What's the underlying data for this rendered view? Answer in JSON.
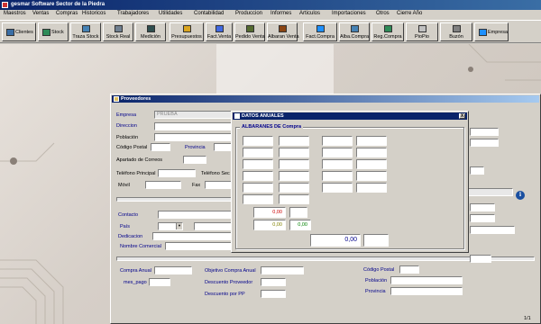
{
  "app": {
    "title": "gesmar Software Sector de la Piedra"
  },
  "menu": [
    "Maestros",
    "Ventas",
    "Compras",
    "Historicos",
    "Trabajadores",
    "Utilidades",
    "Contabilidad",
    "Produccion",
    "Informes",
    "Articulos",
    "Importaciones",
    "Otros",
    "Cierre Año"
  ],
  "toolbar": [
    {
      "label": "Clientes",
      "icon": "clients-icon",
      "color": "#3a6ea5"
    },
    {
      "label": "Stock",
      "icon": "stock-icon",
      "color": "#2e8b57"
    },
    {
      "label": "Traza Stock",
      "icon": "trace-stock-icon",
      "color": "#4682b4"
    },
    {
      "label": "Stock Real",
      "icon": "stock-real-icon",
      "color": "#708090"
    },
    {
      "label": "Medición",
      "icon": "measure-icon",
      "color": "#2f4f4f"
    },
    {
      "label": "Presupuestos",
      "icon": "budget-icon",
      "color": "#daa520"
    },
    {
      "label": "Fact.Venta",
      "icon": "sales-invoice-icon",
      "color": "#4169e1"
    },
    {
      "label": "Pedido Venta",
      "icon": "sales-order-icon",
      "color": "#556b2f"
    },
    {
      "label": "Albaran Venta",
      "icon": "delivery-note-icon",
      "color": "#8b4513"
    },
    {
      "label": "Fact.Compra",
      "icon": "purchase-invoice-icon",
      "color": "#1e90ff"
    },
    {
      "label": "Alba.Compra",
      "icon": "purchase-note-icon",
      "color": "#4682b4"
    },
    {
      "label": "Reg.Compra",
      "icon": "purchase-register-icon",
      "color": "#2e8b57"
    },
    {
      "label": "PioPio",
      "icon": "piopio-icon",
      "color": "#c0c0c0"
    },
    {
      "label": "Buzón",
      "icon": "mailbox-icon",
      "color": "#808080"
    },
    {
      "label": "Empresa",
      "icon": "company-icon",
      "color": "#1e90ff"
    }
  ],
  "proveedores": {
    "title": "Proveedores",
    "empresa_label": "Empresa",
    "empresa_value": "PRUEBA",
    "direccion_label": "Direccion",
    "poblacion_label": "Población",
    "cp_label": "Código Postal",
    "provincia_label": "Provincia",
    "apartado_label": "Apartado de Correos",
    "telefono_label": "Teléfono Principal",
    "telefono_sec_label": "Teléfono Sec",
    "movil_label": "Móvil",
    "fax_label": "Fax",
    "contacto_label": "Contacto",
    "pais_label": "País",
    "dedicacion_label": "Dedicacion",
    "nombre_comercial_label": "Nombre Comercial",
    "compra_anual_label": "Compra Anual",
    "mes_pago_label": "mes_pago",
    "objetivo_label": "Objetivo Compra Anual",
    "descuento_proveedor_label": "Descuento Proveedor",
    "descuento_pp_label": "Descuento por PP",
    "cp2_label": "Código Postal",
    "poblacion2_label": "Población",
    "provincia2_label": "Provincia",
    "info_icon": "info-icon"
  },
  "datos_anuales": {
    "title": "DATOS ANUALES",
    "group_title": "ALBARANES DE Compra",
    "red_value": "0,00",
    "olive_value": "0,00",
    "green_value": "0,00",
    "total_value": "0,00",
    "close_label": "X",
    "colors": {
      "red": "#cc0000",
      "olive": "#808000",
      "green": "#008000",
      "blue": "#00008b"
    }
  },
  "status": {
    "page": "1/1"
  }
}
